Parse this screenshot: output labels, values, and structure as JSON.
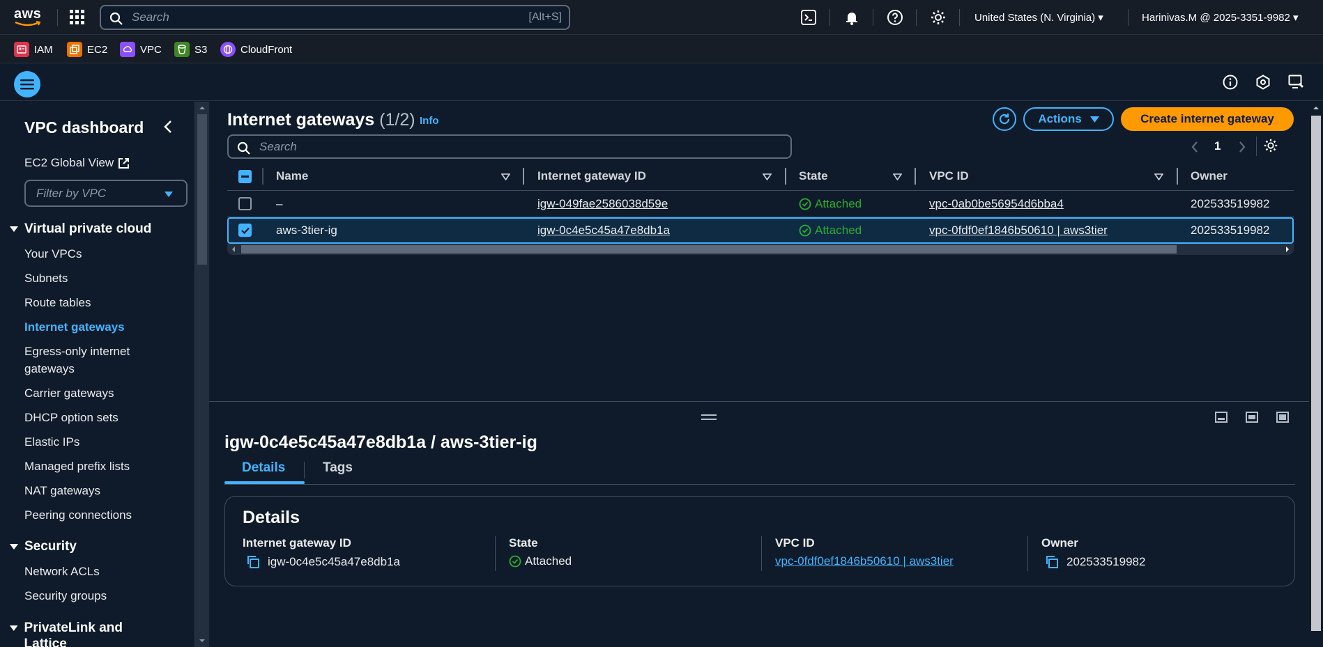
{
  "topnav": {
    "logo": "aws",
    "search_placeholder": "Search",
    "search_shortcut": "[Alt+S]",
    "region": "United States (N. Virginia) ▾",
    "account": "Harinivas.M @ 2025-3351-9982 ▾"
  },
  "favorites": [
    {
      "label": "IAM",
      "color": "#dd344c"
    },
    {
      "label": "EC2",
      "color": "#ed7100"
    },
    {
      "label": "VPC",
      "color": "#8c4fff"
    },
    {
      "label": "S3",
      "color": "#3f8624"
    },
    {
      "label": "CloudFront",
      "color": "#8c4fff"
    }
  ],
  "sidebar": {
    "title": "VPC dashboard",
    "ec2_global_view": "EC2 Global View",
    "filter_placeholder": "Filter by VPC",
    "sections": [
      {
        "label": "Virtual private cloud"
      },
      {
        "label": "Security"
      },
      {
        "label": "PrivateLink and Lattice"
      }
    ],
    "vpc_items": [
      "Your VPCs",
      "Subnets",
      "Route tables",
      "Internet gateways",
      "Egress-only internet gateways",
      "Carrier gateways",
      "DHCP option sets",
      "Elastic IPs",
      "Managed prefix lists",
      "NAT gateways",
      "Peering connections"
    ],
    "security_items": [
      "Network ACLs",
      "Security groups"
    ]
  },
  "main": {
    "title": "Internet gateways",
    "count": "(1/2)",
    "info": "Info",
    "actions_label": "Actions",
    "create_label": "Create internet gateway",
    "search_placeholder": "Search",
    "page_number": "1",
    "columns": [
      "Name",
      "Internet gateway ID",
      "State",
      "VPC ID",
      "Owner"
    ],
    "rows": [
      {
        "name": "–",
        "igw_id": "igw-049fae2586038d59e",
        "state": "Attached",
        "vpc_id": "vpc-0ab0be56954d6bba4",
        "owner": "202533519982"
      },
      {
        "name": "aws-3tier-ig",
        "igw_id": "igw-0c4e5c45a47e8db1a",
        "state": "Attached",
        "vpc_id": "vpc-0fdf0ef1846b50610 | aws3tier",
        "owner": "202533519982"
      }
    ]
  },
  "details": {
    "title": "igw-0c4e5c45a47e8db1a / aws-3tier-ig",
    "tabs": [
      "Details",
      "Tags"
    ],
    "card_title": "Details",
    "fields": [
      {
        "label": "Internet gateway ID",
        "value": "igw-0c4e5c45a47e8db1a"
      },
      {
        "label": "State",
        "value": "Attached"
      },
      {
        "label": "VPC ID",
        "value": "vpc-0fdf0ef1846b50610 | aws3tier"
      },
      {
        "label": "Owner",
        "value": "202533519982"
      }
    ]
  }
}
